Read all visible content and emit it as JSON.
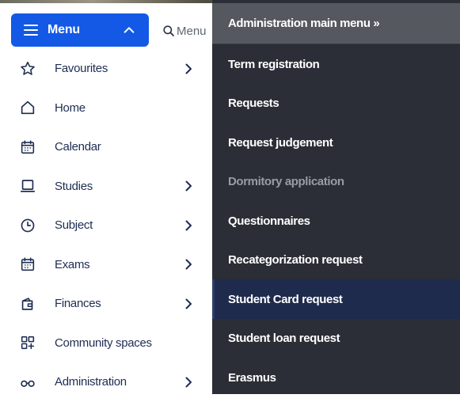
{
  "header": {
    "menu_label": "Menu",
    "search_placeholder": "Menu"
  },
  "sidebar": {
    "items": [
      {
        "label": "Favourites",
        "icon": "star-icon",
        "has_submenu": true
      },
      {
        "label": "Home",
        "icon": "home-icon",
        "has_submenu": false
      },
      {
        "label": "Calendar",
        "icon": "calendar-icon",
        "has_submenu": false
      },
      {
        "label": "Studies",
        "icon": "laptop-icon",
        "has_submenu": true
      },
      {
        "label": "Subject",
        "icon": "clock-icon",
        "has_submenu": true
      },
      {
        "label": "Exams",
        "icon": "calendar-exam-icon",
        "has_submenu": true
      },
      {
        "label": "Finances",
        "icon": "wallet-icon",
        "has_submenu": true
      },
      {
        "label": "Community spaces",
        "icon": "grid-plus-icon",
        "has_submenu": false
      },
      {
        "label": "Administration",
        "icon": "glasses-icon",
        "has_submenu": true
      }
    ]
  },
  "submenu": {
    "title": "Administration main menu »",
    "items": [
      {
        "label": "Term registration",
        "state": "normal"
      },
      {
        "label": "Requests",
        "state": "normal"
      },
      {
        "label": "Request judgement",
        "state": "normal"
      },
      {
        "label": "Dormitory application",
        "state": "disabled"
      },
      {
        "label": "Questionnaires",
        "state": "normal"
      },
      {
        "label": "Recategorization request",
        "state": "normal"
      },
      {
        "label": "Student Card request",
        "state": "active"
      },
      {
        "label": "Student loan request",
        "state": "normal"
      },
      {
        "label": "Erasmus",
        "state": "normal"
      }
    ]
  },
  "colors": {
    "menu_button_bg": "#1359e6",
    "sidebar_text": "#1e2d52",
    "panel_bg": "#2b2e36",
    "panel_header_bg": "#55595f",
    "panel_active_bg": "#1f2b4d",
    "panel_disabled_text": "#9a9ca3"
  }
}
